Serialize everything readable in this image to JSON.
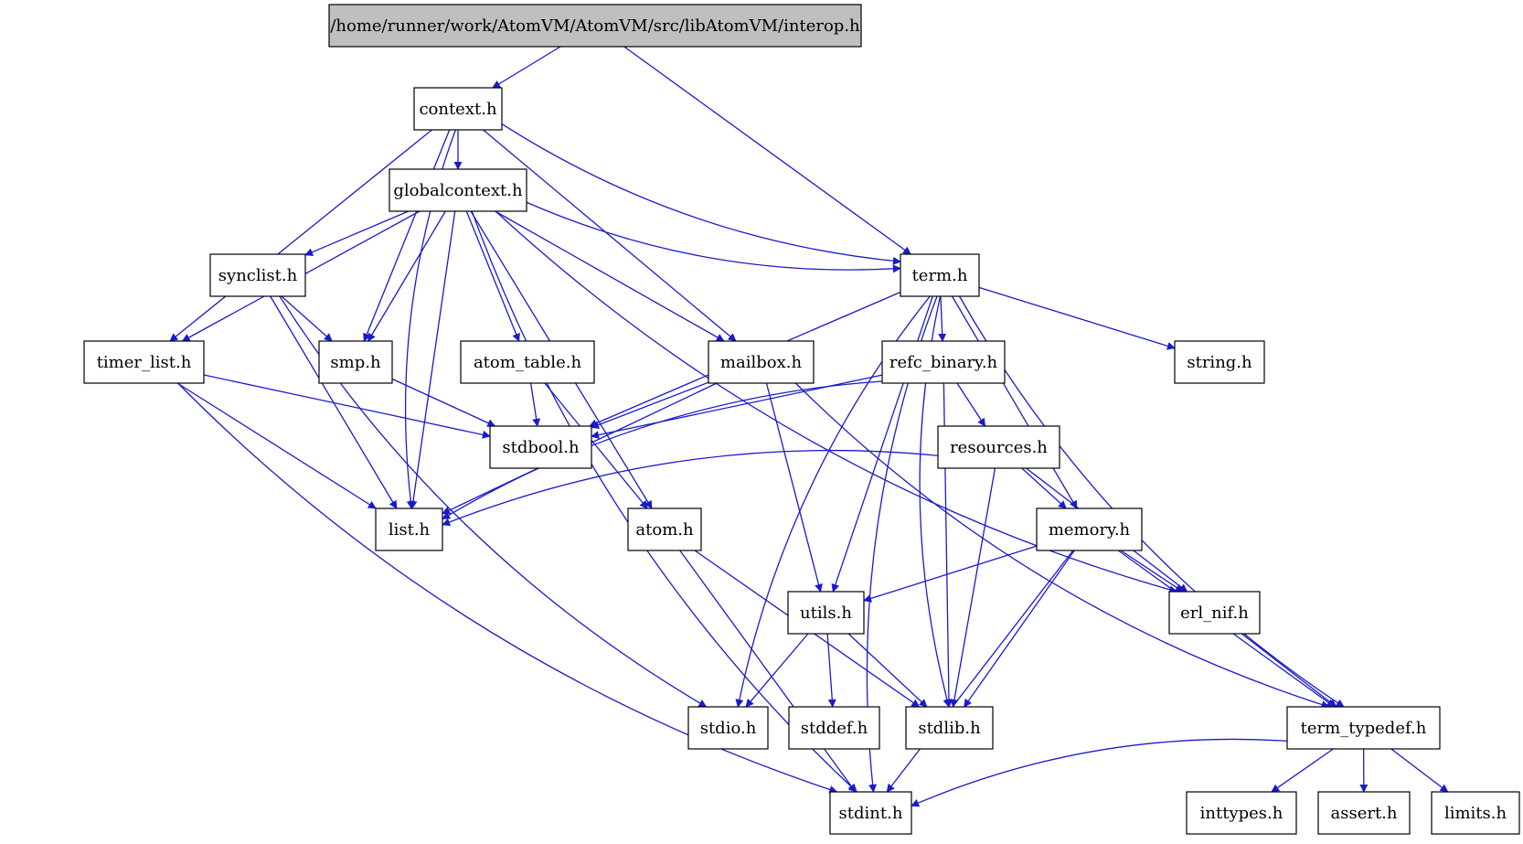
{
  "diagram": {
    "title": "/home/runner/work/AtomVM/AtomVM/src/libAtomVM/interop.h",
    "edge_color": "#1a1acd",
    "root_fill": "#bfbfbf",
    "node_fill": "#ffffff",
    "nodes": [
      {
        "id": "interop",
        "label": "/home/runner/work/AtomVM/AtomVM/src/libAtomVM/interop.h",
        "root": true
      },
      {
        "id": "context",
        "label": "context.h"
      },
      {
        "id": "globalcontext",
        "label": "globalcontext.h"
      },
      {
        "id": "synclist",
        "label": "synclist.h"
      },
      {
        "id": "term",
        "label": "term.h"
      },
      {
        "id": "timer_list",
        "label": "timer_list.h"
      },
      {
        "id": "smp",
        "label": "smp.h"
      },
      {
        "id": "atom_table",
        "label": "atom_table.h"
      },
      {
        "id": "mailbox",
        "label": "mailbox.h"
      },
      {
        "id": "refc_binary",
        "label": "refc_binary.h"
      },
      {
        "id": "string",
        "label": "string.h"
      },
      {
        "id": "stdbool",
        "label": "stdbool.h"
      },
      {
        "id": "resources",
        "label": "resources.h"
      },
      {
        "id": "list",
        "label": "list.h"
      },
      {
        "id": "atom",
        "label": "atom.h"
      },
      {
        "id": "memory",
        "label": "memory.h"
      },
      {
        "id": "utils",
        "label": "utils.h"
      },
      {
        "id": "erl_nif",
        "label": "erl_nif.h"
      },
      {
        "id": "stdio",
        "label": "stdio.h"
      },
      {
        "id": "stddef",
        "label": "stddef.h"
      },
      {
        "id": "stdlib",
        "label": "stdlib.h"
      },
      {
        "id": "term_typedef",
        "label": "term_typedef.h"
      },
      {
        "id": "stdint",
        "label": "stdint.h"
      },
      {
        "id": "inttypes",
        "label": "inttypes.h"
      },
      {
        "id": "assert",
        "label": "assert.h"
      },
      {
        "id": "limits",
        "label": "limits.h"
      }
    ],
    "edges": [
      [
        "interop",
        "context"
      ],
      [
        "interop",
        "term"
      ],
      [
        "context",
        "globalcontext"
      ],
      [
        "context",
        "timer_list"
      ],
      [
        "context",
        "smp"
      ],
      [
        "context",
        "mailbox"
      ],
      [
        "context",
        "term"
      ],
      [
        "context",
        "list"
      ],
      [
        "globalcontext",
        "synclist"
      ],
      [
        "globalcontext",
        "timer_list"
      ],
      [
        "globalcontext",
        "smp"
      ],
      [
        "globalcontext",
        "atom_table"
      ],
      [
        "globalcontext",
        "mailbox"
      ],
      [
        "globalcontext",
        "term"
      ],
      [
        "globalcontext",
        "list"
      ],
      [
        "globalcontext",
        "atom"
      ],
      [
        "globalcontext",
        "erl_nif"
      ],
      [
        "globalcontext",
        "stdint"
      ],
      [
        "synclist",
        "smp"
      ],
      [
        "synclist",
        "list"
      ],
      [
        "synclist",
        "stdio"
      ],
      [
        "timer_list",
        "list"
      ],
      [
        "timer_list",
        "stdbool"
      ],
      [
        "timer_list",
        "stdint"
      ],
      [
        "smp",
        "stdbool"
      ],
      [
        "atom_table",
        "stdbool"
      ],
      [
        "atom_table",
        "atom"
      ],
      [
        "mailbox",
        "stdbool"
      ],
      [
        "mailbox",
        "list"
      ],
      [
        "mailbox",
        "utils"
      ],
      [
        "mailbox",
        "term_typedef"
      ],
      [
        "term",
        "refc_binary"
      ],
      [
        "term",
        "string"
      ],
      [
        "term",
        "stdbool"
      ],
      [
        "term",
        "memory"
      ],
      [
        "term",
        "utils"
      ],
      [
        "term",
        "stdio"
      ],
      [
        "term",
        "stdlib"
      ],
      [
        "term",
        "stdint"
      ],
      [
        "term",
        "term_typedef"
      ],
      [
        "refc_binary",
        "resources"
      ],
      [
        "refc_binary",
        "stdbool"
      ],
      [
        "refc_binary",
        "list"
      ],
      [
        "refc_binary",
        "stdlib"
      ],
      [
        "resources",
        "memory"
      ],
      [
        "resources",
        "list"
      ],
      [
        "resources",
        "erl_nif"
      ],
      [
        "resources",
        "stdlib"
      ],
      [
        "atom",
        "stdlib"
      ],
      [
        "atom",
        "stdint"
      ],
      [
        "memory",
        "utils"
      ],
      [
        "memory",
        "erl_nif"
      ],
      [
        "memory",
        "stdlib"
      ],
      [
        "memory",
        "stdint"
      ],
      [
        "memory",
        "term_typedef"
      ],
      [
        "utils",
        "stdio"
      ],
      [
        "utils",
        "stddef"
      ],
      [
        "utils",
        "stdlib"
      ],
      [
        "erl_nif",
        "term_typedef"
      ],
      [
        "term_typedef",
        "stdint"
      ],
      [
        "term_typedef",
        "inttypes"
      ],
      [
        "term_typedef",
        "assert"
      ],
      [
        "term_typedef",
        "limits"
      ]
    ]
  }
}
